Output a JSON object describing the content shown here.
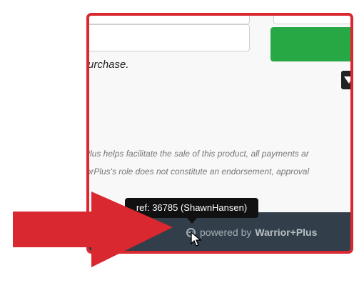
{
  "checkout": {
    "purchase_note": "urchase.",
    "buy_button_color": "#28a745"
  },
  "disclaimer": {
    "line1": "rPlus helps facilitate the sale of this product, all payments ar",
    "line2": "riorPlus's role does not constitute an endorsement, approval"
  },
  "footer": {
    "powered_prefix": "powered by",
    "brand": "Warrior+Plus",
    "background": "#323e49"
  },
  "tooltip": {
    "text": "ref: 36785 (ShawnHansen)"
  },
  "annotations": {
    "frame_color": "#d9282f",
    "arrow_color": "#d9282f",
    "arrow_direction": "right"
  },
  "icons": [
    "warriorplus-logo-icon",
    "cursor-pointer-icon",
    "arrow-annotation-icon"
  ]
}
